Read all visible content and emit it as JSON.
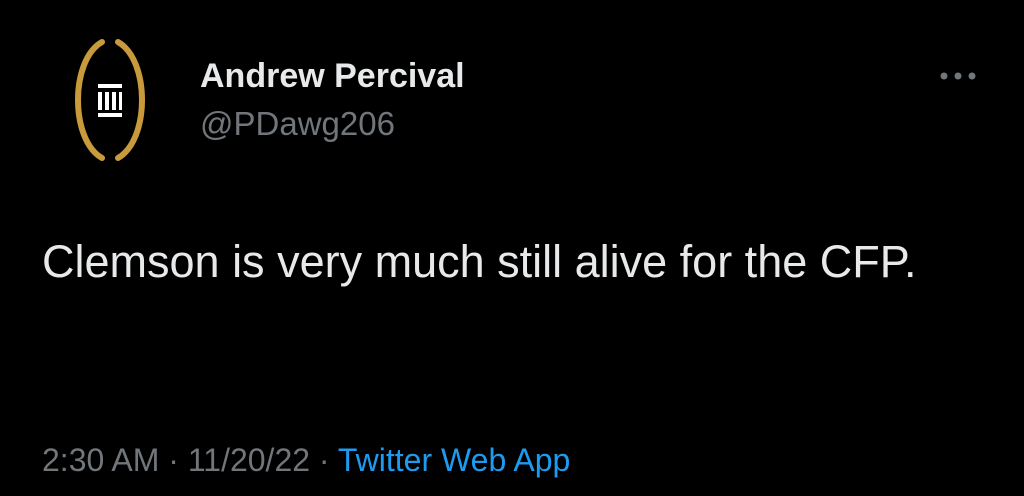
{
  "author": {
    "display_name": "Andrew Percival",
    "handle": "@PDawg206",
    "avatar_icon": "cfp-logo-icon",
    "avatar_color": "#c99a3b"
  },
  "tweet": {
    "text": "Clemson is very much still alive for the CFP.",
    "time": "2:30 AM",
    "separator": "·",
    "date": "11/20/22",
    "source": "Twitter Web App"
  },
  "more_icon": "more-horizontal-icon",
  "colors": {
    "background": "#000000",
    "primary_text": "#e7e9ea",
    "secondary_text": "#71767b",
    "link": "#1d9bf0"
  }
}
